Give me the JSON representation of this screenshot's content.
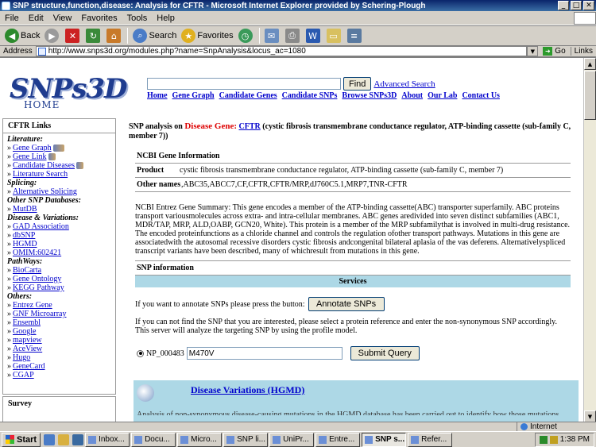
{
  "window": {
    "title": "SNP structure,function,disease: Analysis for CFTR - Microsoft Internet Explorer provided by Schering-Plough"
  },
  "menu": [
    "File",
    "Edit",
    "View",
    "Favorites",
    "Tools",
    "Help"
  ],
  "toolbar": {
    "back": "Back",
    "search": "Search",
    "favorites": "Favorites"
  },
  "address": {
    "label": "Address",
    "url": "http://www.snps3d.org/modules.php?name=SnpAnalysis&locus_ac=1080",
    "go": "Go",
    "links": "Links"
  },
  "header": {
    "logo": "SNPs3D",
    "logo_sub": "HOME",
    "find_label": "Find",
    "advanced_search": "Advanced Search",
    "nav": [
      "Home",
      "Gene Graph",
      "Candidate Genes",
      "Candidate SNPs",
      "Browse SNPs3D",
      "About",
      "Our Lab",
      "Contact Us"
    ]
  },
  "sidebar": {
    "title": "CFTR Links",
    "sections": [
      {
        "category": "Literature:",
        "items": [
          "Gene Graph",
          "Gene Link",
          "Candidate Diseases",
          "Literature Search"
        ]
      },
      {
        "category": "Splicing:",
        "items": [
          "Alternative Splicing"
        ]
      },
      {
        "category": "Other SNP Databases:",
        "items": [
          "MutDB"
        ]
      },
      {
        "category": "Disease & Variations:",
        "items": [
          "GAD Association",
          "dbSNP",
          "HGMD",
          "OMIM:602421"
        ]
      },
      {
        "category": "PathWays:",
        "items": [
          "BioCarta",
          "Gene Ontology",
          "KEGG Pathway"
        ]
      },
      {
        "category": "Others:",
        "items": [
          "Entrez Gene",
          "GNF Microarray",
          "Ensembl",
          "Google",
          "mapview",
          "AceView",
          "Hugo",
          "GeneCard",
          "CGAP"
        ]
      }
    ],
    "survey": "Survey"
  },
  "main": {
    "heading_prefix": "SNP analysis on",
    "disease_gene": "Disease Gene:",
    "gene": "CFTR",
    "gene_desc": "(cystic fibrosis transmembrane conductance regulator, ATP-binding cassette (sub-family C, member 7))",
    "ncbi": {
      "title": "NCBI Gene Information",
      "product_label": "Product",
      "product": "cystic fibrosis transmembrane conductance regulator, ATP-binding cassette (sub-family C, member 7)",
      "other_names_label": "Other names",
      "other_names": ",ABC35,ABCC7,CF,CFTR,CFTR/MRP,dJ760C5.1,MRP7,TNR-CFTR"
    },
    "summary": "NCBI Entrez Gene Summary: This gene encodes a member of the ATP-binding cassette(ABC) transporter superfamily. ABC proteins transport variousmolecules across extra- and intra-cellular membranes. ABC genes aredivided into seven distinct subfamilies (ABC1, MDR/TAP, MRP, ALD,OABP, GCN20, White). This protein is a member of the MRP subfamilythat is involved in multi-drug resistance. The encoded proteinfunctions as a chloride channel and controls the regulation ofother transport pathways. Mutations in this gene are associatedwith the autosomal recessive disorders cystic fibrosis andcongenital bilateral aplasia of the vas deferens. Alternativelyspliced transcript variants have been described, many of whichresult from mutations in this gene.",
    "snp_info_title": "SNP information",
    "services": "Services",
    "annotate_text": "If you want to annotate SNPs please press the button:",
    "annotate_button": "Annotate SNPs",
    "notfound_text": "If you can not find the SNP that you are interested, please select a protein reference and enter the non-synonymous SNP accordingly. This server will analyze the targeting SNP by using the profile model.",
    "protein_ref": "NP_000483",
    "snp_value": "M470V",
    "submit_button": "Submit Query",
    "hgmd_title": "Disease Variations (HGMD)",
    "hgmd_cut": "Analysis of non-synonymous disease-causing mutations in the HGMD database has been carried out to identify how those mutations"
  },
  "status": {
    "zone": "Internet"
  },
  "taskbar": {
    "start": "Start",
    "tasks": [
      "Inbox...",
      "Docu...",
      "Micro...",
      "SNP li...",
      "UniPr...",
      "Entre...",
      "SNP s...",
      "Refer..."
    ],
    "active_index": 6,
    "clock": "1:38 PM"
  }
}
